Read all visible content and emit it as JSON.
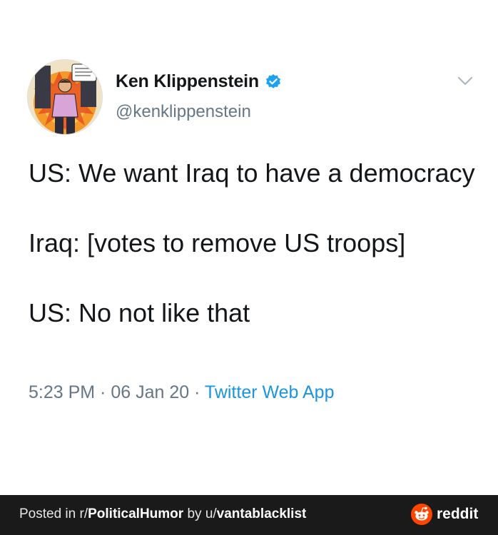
{
  "tweet": {
    "display_name": "Ken Klippenstein",
    "handle": "@kenklippenstein",
    "lines": [
      "US: We want Iraq to have a democracy",
      "Iraq: [votes to remove US troops]",
      "US: No not like that"
    ],
    "time": "5:23 PM",
    "separator": " · ",
    "date": "06 Jan 20",
    "source": "Twitter Web App",
    "avatar_icon": "comic-portrait-avatar",
    "verified_icon": "verified-badge-icon",
    "menu_icon": "chevron-down-icon"
  },
  "footer": {
    "posted_in_prefix": "Posted in ",
    "subreddit_prefix": "r/",
    "subreddit": "PoliticalHumor",
    "by_text": " by ",
    "user_prefix": "u/",
    "username": "vantablacklist",
    "brand": "reddit"
  },
  "colors": {
    "text": "#14171a",
    "muted": "#657786",
    "link": "#1b95e0",
    "verified": "#1da1f2",
    "footer_bg": "#1a1a1b",
    "reddit_orange": "#ff4500"
  }
}
